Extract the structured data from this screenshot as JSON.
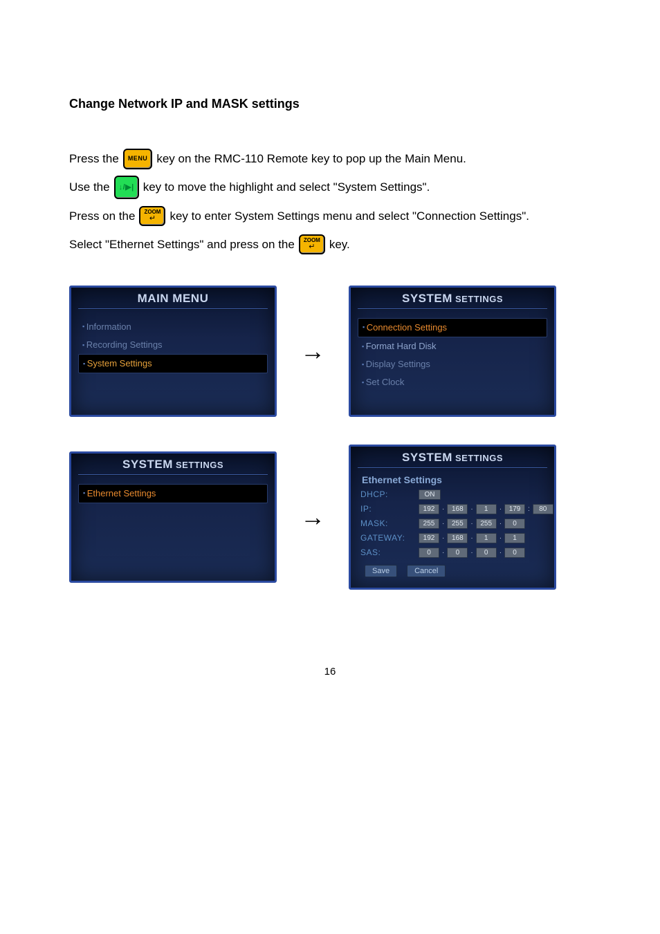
{
  "heading": "Change Network IP and MASK settings",
  "instructions": {
    "l1a": "Press the",
    "l1b": "key on the RMC-110 Remote key to pop up the Main Menu.",
    "l2a": "Use the",
    "l2b": "key to move the highlight and select \"System Settings\".",
    "l3a": "Press on the",
    "l3b": "key to enter System Settings menu and select  \"Connection Settings\".",
    "l4a": "Select  \"Ethernet Settings\" and press on the",
    "l4b": "key."
  },
  "keys": {
    "menu": "MENU",
    "updown": "↓/▶|",
    "zoom": "ZOOM",
    "enter": "↵"
  },
  "screens": {
    "main_menu": {
      "title_big": "MAIN MENU",
      "items": [
        "Information",
        "Recording Settings",
        "System Settings"
      ],
      "selected_index": 2
    },
    "system_settings_1": {
      "title_big": "SYSTEM",
      "title_small": " SETTINGS",
      "items": [
        "Connection Settings",
        "Format Hard Disk",
        "Display Settings",
        "Set Clock"
      ],
      "selected_index": 0
    },
    "system_settings_2": {
      "title_big": "SYSTEM",
      "title_small": " SETTINGS",
      "items": [
        "Ethernet Settings"
      ],
      "selected_index": 0
    },
    "ethernet": {
      "title_big": "SYSTEM",
      "title_small": " SETTINGS",
      "subheading": "Ethernet Settings",
      "labels": {
        "dhcp": "DHCP:",
        "ip": "IP:",
        "mask": "MASK:",
        "gateway": "GATEWAY:",
        "sas": "SAS:"
      },
      "dhcp_value": "ON",
      "ip": [
        "192",
        "168",
        "1",
        "179",
        "80"
      ],
      "mask": [
        "255",
        "255",
        "255",
        "0"
      ],
      "gateway": [
        "192",
        "168",
        "1",
        "1"
      ],
      "sas": [
        "0",
        "0",
        "0",
        "0"
      ],
      "buttons": {
        "save": "Save",
        "cancel": "Cancel"
      }
    }
  },
  "page_number": "16"
}
